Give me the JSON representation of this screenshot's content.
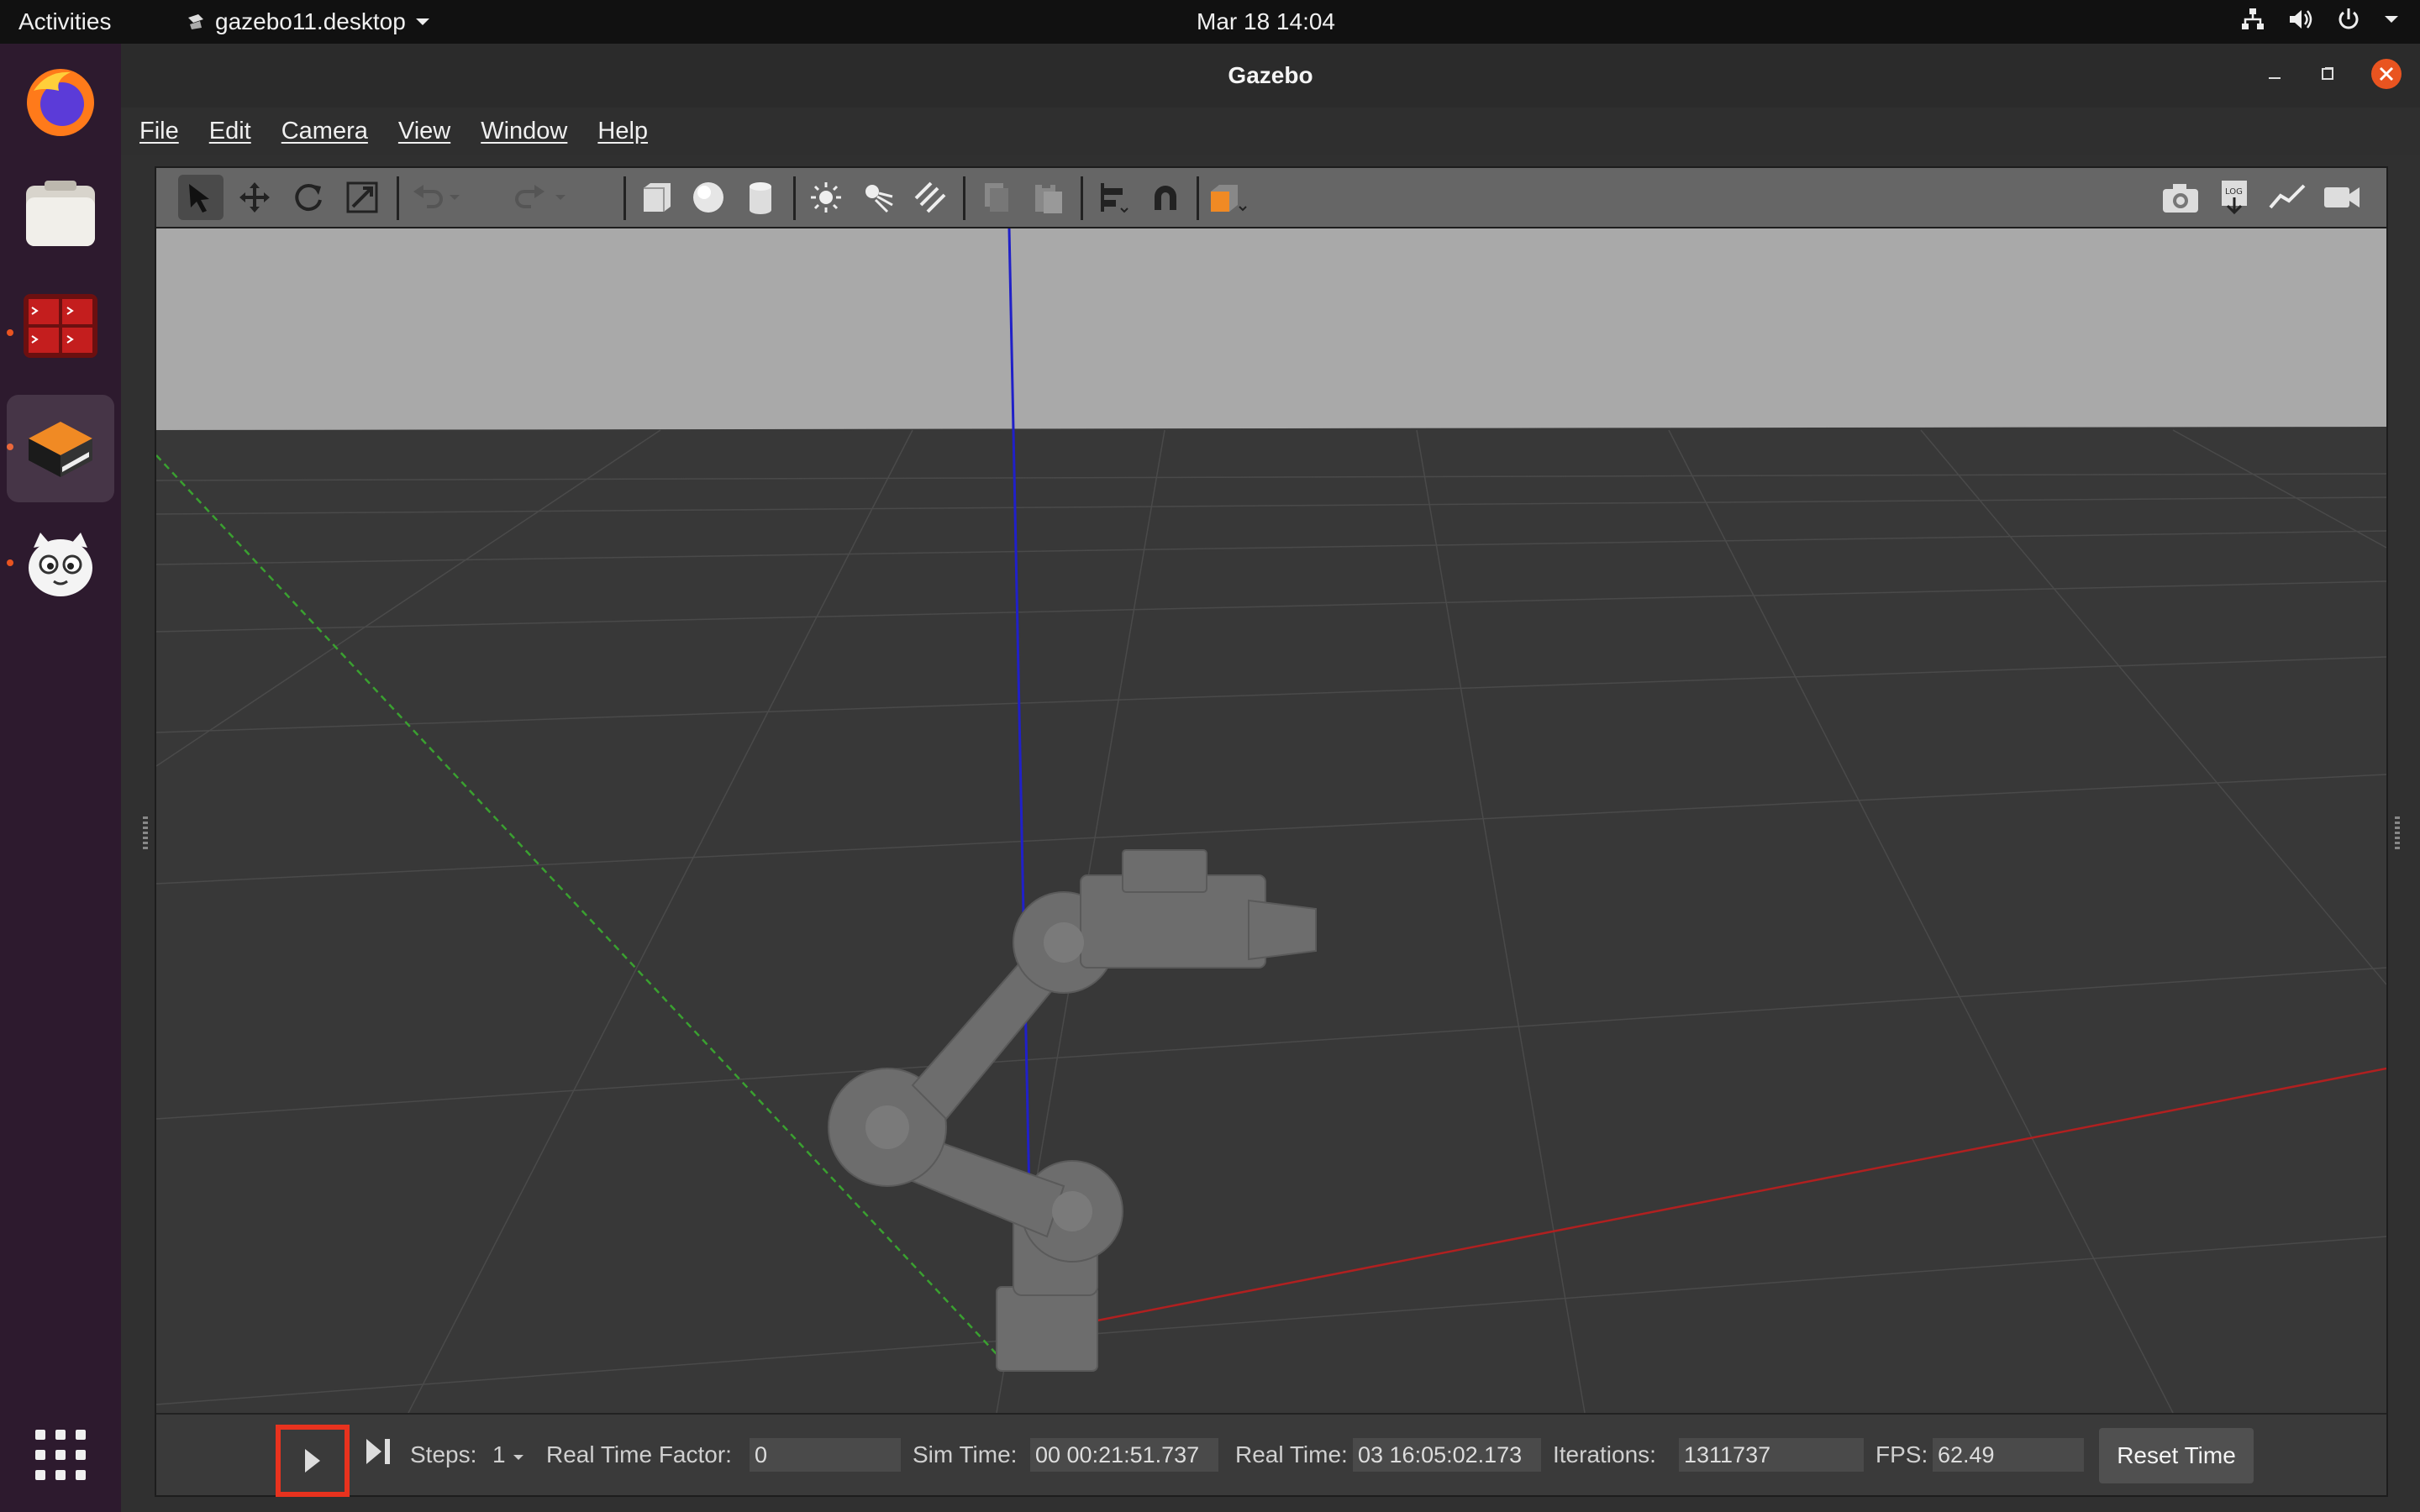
{
  "topbar": {
    "activities": "Activities",
    "app_name": "gazebo11.desktop",
    "clock": "Mar 18  14:04"
  },
  "window": {
    "title": "Gazebo"
  },
  "menu": [
    "File",
    "Edit",
    "Camera",
    "View",
    "Window",
    "Help"
  ],
  "toolbar_icons": [
    "select-arrow-icon",
    "translate-icon",
    "rotate-icon",
    "scale-icon",
    "undo-icon",
    "redo-icon",
    "box-icon",
    "sphere-icon",
    "cylinder-icon",
    "point-light-icon",
    "spot-light-icon",
    "directional-light-icon",
    "copy-icon",
    "paste-icon",
    "align-icon",
    "snap-magnet-icon",
    "view-angle-icon",
    "screenshot-camera-icon",
    "log-icon",
    "plot-icon",
    "video-record-icon"
  ],
  "bottom": {
    "steps_label": "Steps:",
    "steps_value": "1",
    "rtf_label": "Real Time Factor:",
    "rtf_value": "0",
    "sim_time_label": "Sim Time:",
    "sim_time_value": "00 00:21:51.737",
    "real_time_label": "Real Time:",
    "real_time_value": "03 16:05:02.173",
    "iterations_label": "Iterations:",
    "iterations_value": "1311737",
    "fps_label": "FPS:",
    "fps_value": "62.49",
    "reset_label": "Reset Time"
  },
  "colors": {
    "highlight": "#e8321e",
    "axis_x": "#b02020",
    "axis_y": "#3aa030",
    "axis_z": "#2020c8",
    "ubuntu_orange": "#e95420"
  }
}
